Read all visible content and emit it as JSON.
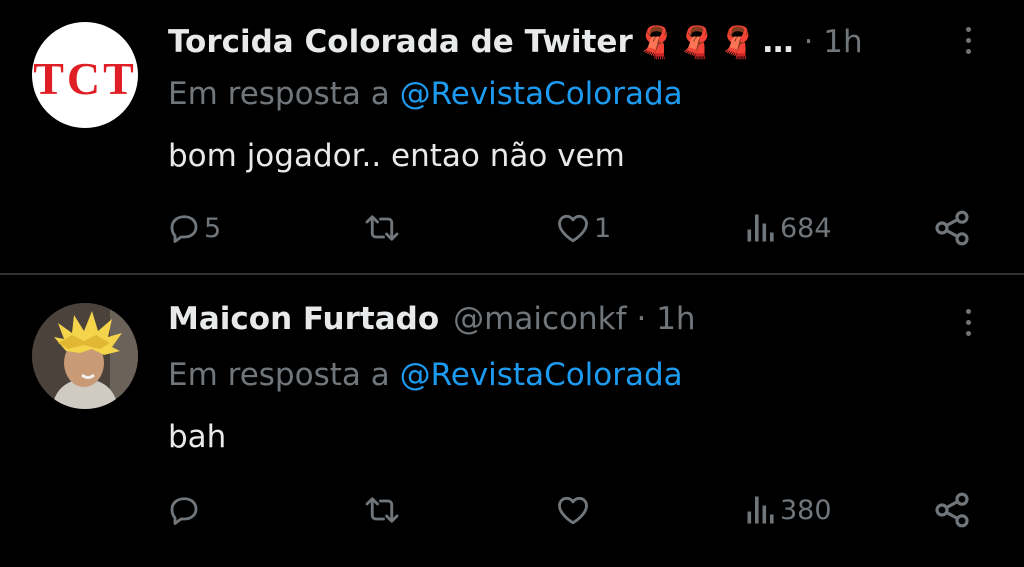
{
  "tweets": [
    {
      "author_name": "Torcida Colorada de Twiter",
      "author_handle_truncated": "…",
      "time": "· 1h",
      "avatar_text": "TCT",
      "scarf_emoji": "🧣",
      "reply_prefix": "Em resposta a",
      "reply_to": "@RevistaColorada",
      "text": "bom jogador.. entao não vem",
      "replies": "5",
      "retweets": "",
      "likes": "1",
      "views": "684"
    },
    {
      "author_name": "Maicon Furtado",
      "author_handle": "@maiconkf",
      "time": "· 1h",
      "reply_prefix": "Em resposta a",
      "reply_to": "@RevistaColorada",
      "text": "bah",
      "replies": "",
      "retweets": "",
      "likes": "",
      "views": "380"
    }
  ],
  "colors": {
    "background": "#000000",
    "text": "#e7e9ea",
    "muted": "#71767b",
    "link": "#1d9bf0",
    "divider": "#2f3336",
    "tct_red": "#e01e26"
  },
  "icons": [
    "reply-icon",
    "retweet-icon",
    "like-icon",
    "views-icon",
    "share-icon",
    "more-icon",
    "scarf-emoji"
  ]
}
